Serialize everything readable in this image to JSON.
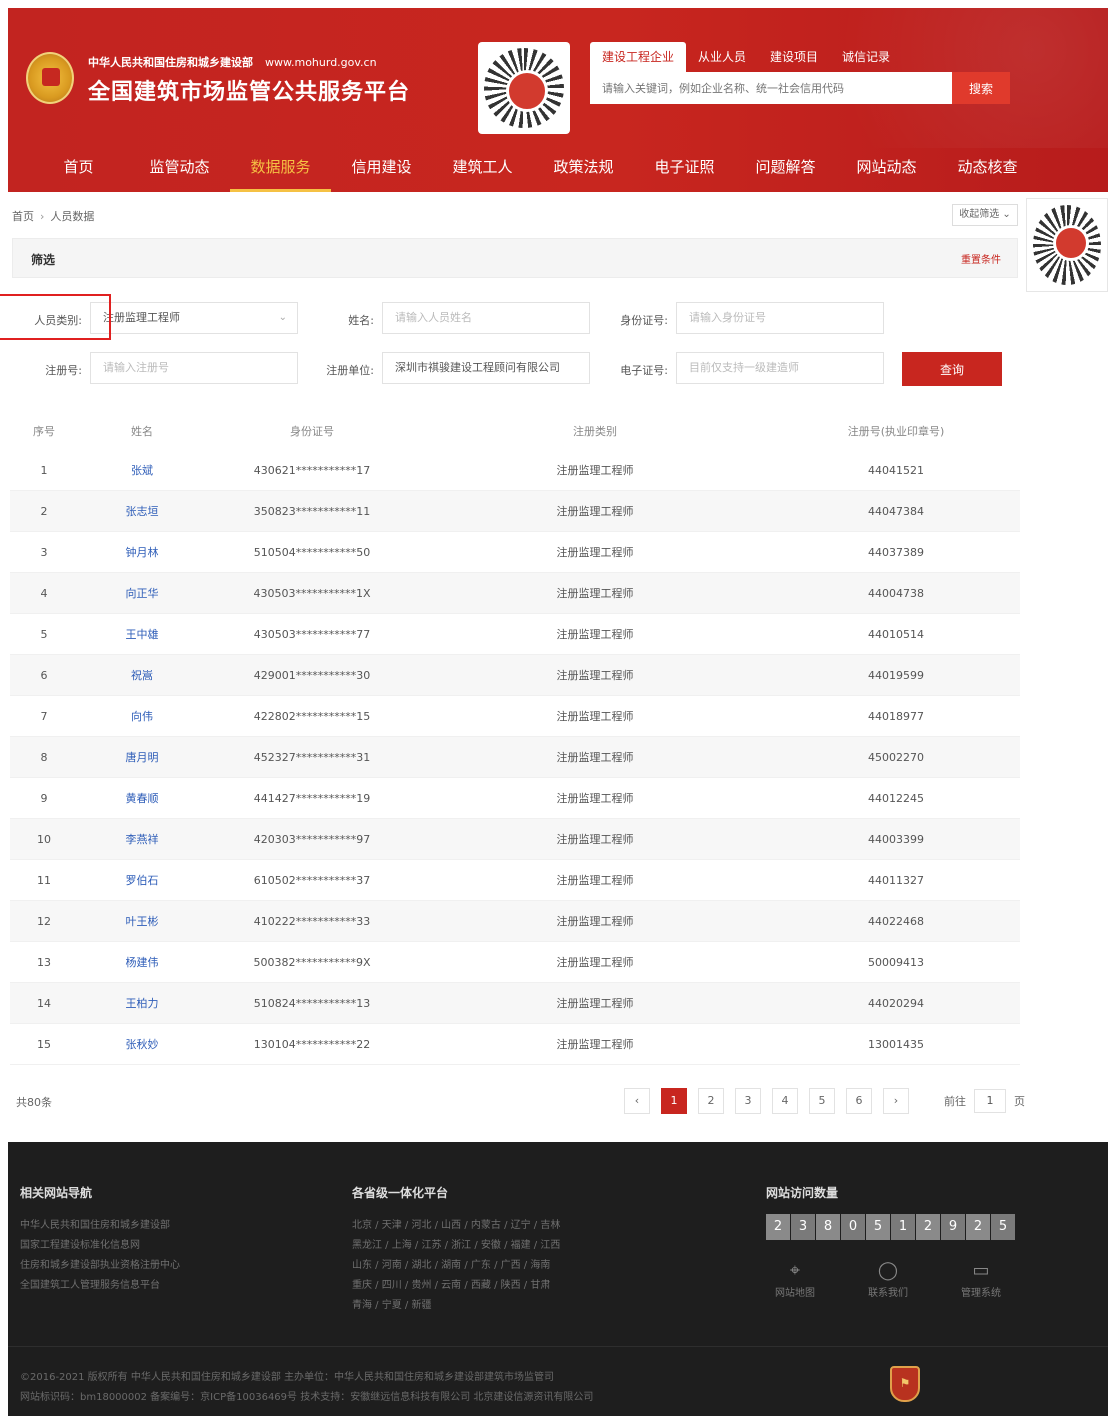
{
  "header": {
    "ministry": "中华人民共和国住房和城乡建设部",
    "url": "www.mohurd.gov.cn",
    "title": "全国建筑市场监管公共服务平台",
    "search_tabs": [
      "建设工程企业",
      "从业人员",
      "建设项目",
      "诚信记录"
    ],
    "search_placeholder": "请输入关键词，例如企业名称、统一社会信用代码",
    "search_button": "搜索"
  },
  "nav": {
    "items": [
      "首页",
      "监管动态",
      "数据服务",
      "信用建设",
      "建筑工人",
      "政策法规",
      "电子证照",
      "问题解答",
      "网站动态",
      "动态核查"
    ],
    "active": "数据服务"
  },
  "breadcrumb": {
    "home": "首页",
    "current": "人员数据"
  },
  "collect_button": "收起筛选",
  "filter": {
    "title": "筛选",
    "reset": "重置条件",
    "category_label": "人员类别:",
    "category_value": "注册监理工程师",
    "name_label": "姓名:",
    "name_placeholder": "请输入人员姓名",
    "id_label": "身份证号:",
    "id_placeholder": "请输入身份证号",
    "reg_label": "注册号:",
    "reg_placeholder": "请输入注册号",
    "unit_label": "注册单位:",
    "unit_value": "深圳市祺骏建设工程顾问有限公司",
    "ecert_label": "电子证号:",
    "ecert_placeholder": "目前仅支持一级建造师",
    "query_button": "查询"
  },
  "table": {
    "headers": [
      "序号",
      "姓名",
      "身份证号",
      "注册类别",
      "注册号(执业印章号)"
    ],
    "rows": [
      [
        "1",
        "张斌",
        "430621***********17",
        "注册监理工程师",
        "44041521"
      ],
      [
        "2",
        "张志垣",
        "350823***********11",
        "注册监理工程师",
        "44047384"
      ],
      [
        "3",
        "钟月林",
        "510504***********50",
        "注册监理工程师",
        "44037389"
      ],
      [
        "4",
        "向正华",
        "430503***********1X",
        "注册监理工程师",
        "44004738"
      ],
      [
        "5",
        "王中雄",
        "430503***********77",
        "注册监理工程师",
        "44010514"
      ],
      [
        "6",
        "祝嵩",
        "429001***********30",
        "注册监理工程师",
        "44019599"
      ],
      [
        "7",
        "向伟",
        "422802***********15",
        "注册监理工程师",
        "44018977"
      ],
      [
        "8",
        "唐月明",
        "452327***********31",
        "注册监理工程师",
        "45002270"
      ],
      [
        "9",
        "黄春顺",
        "441427***********19",
        "注册监理工程师",
        "44012245"
      ],
      [
        "10",
        "李燕祥",
        "420303***********97",
        "注册监理工程师",
        "44003399"
      ],
      [
        "11",
        "罗伯石",
        "610502***********37",
        "注册监理工程师",
        "44011327"
      ],
      [
        "12",
        "叶王彬",
        "410222***********33",
        "注册监理工程师",
        "44022468"
      ],
      [
        "13",
        "杨建伟",
        "500382***********9X",
        "注册监理工程师",
        "50009413"
      ],
      [
        "14",
        "王柏力",
        "510824***********13",
        "注册监理工程师",
        "44020294"
      ],
      [
        "15",
        "张秋妙",
        "130104***********22",
        "注册监理工程师",
        "13001435"
      ]
    ]
  },
  "pagination": {
    "total": "共80条",
    "prev": "‹",
    "next": "›",
    "pages": [
      "1",
      "2",
      "3",
      "4",
      "5",
      "6"
    ],
    "current": "1",
    "goto_label": "前往",
    "goto_value": "1",
    "page_unit": "页"
  },
  "footer": {
    "nav_title": "相关网站导航",
    "nav_links": [
      "中华人民共和国住房和城乡建设部",
      "国家工程建设标准化信息网",
      "住房和城乡建设部执业资格注册中心",
      "全国建筑工人管理服务信息平台"
    ],
    "platform_title": "各省级一体化平台",
    "platform_lines": [
      "北京 / 天津 / 河北 / 山西 / 内蒙古 / 辽宁 / 吉林",
      "黑龙江 / 上海 / 江苏 / 浙江 / 安徽 / 福建 / 江西",
      "山东 / 河南 / 湖北 / 湖南 / 广东 / 广西 / 海南",
      "重庆 / 四川 / 贵州 / 云南 / 西藏 / 陕西 / 甘肃",
      "青海 / 宁夏 / 新疆"
    ],
    "visits_title": "网站访问数量",
    "visit_digits": [
      "2",
      "3",
      "8",
      "0",
      "5",
      "1",
      "2",
      "9",
      "2",
      "5"
    ],
    "tools": [
      {
        "label": "网站地图",
        "icon": "map-pin-icon"
      },
      {
        "label": "联系我们",
        "icon": "chat-icon"
      },
      {
        "label": "管理系统",
        "icon": "monitor-icon"
      }
    ],
    "copyright_1": "©2016-2021 版权所有 中华人民共和国住房和城乡建设部   主办单位：中华人民共和国住房和城乡建设部建筑市场监管司",
    "copyright_2": "网站标识码：bm18000002   备案编号：京ICP备10036469号   技术支持：安徽继远信息科技有限公司 北京建设信源资讯有限公司"
  },
  "colors": {
    "brand_red": "#c8261f",
    "nav_active": "#f5c144",
    "link_blue": "#2e5db8",
    "footer_bg": "#1e1e1e"
  }
}
